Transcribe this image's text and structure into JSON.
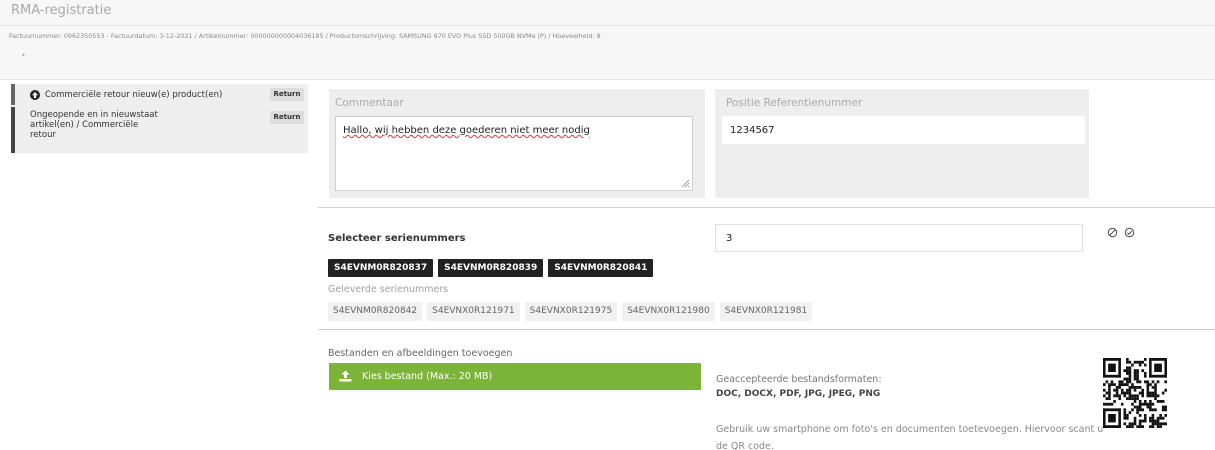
{
  "page": {
    "title": "RMA-registratie",
    "invoice_info": "Factuurnummer: 0962350553 - Factuurdatum: 3-12-2021 / Artikelnummer: 000000000004036185 / Productomschrijving: SAMSUNG 970 EVO Plus SSD 500GB NVMe (P) / Hoeveelheid: 8",
    "dot": "•"
  },
  "sidebar": {
    "items": [
      {
        "label": "Commerciële retour nieuw(e) product(en)",
        "badge": "Return",
        "icon": "arrow-up-circle-icon"
      },
      {
        "label_lines": [
          "Ongeopende en in nieuwstaat",
          "artikel(en) / Commerciële",
          "retour"
        ],
        "badge": "Return"
      }
    ]
  },
  "comment": {
    "label": "Commentaar",
    "value": "Hallo, wij hebben deze goederen niet meer nodig"
  },
  "reference": {
    "label": "Positie Referentienummer",
    "value": "1234567"
  },
  "serials": {
    "title": "Selecteer serienummers",
    "count_value": "3",
    "selected": [
      "S4EVNM0R820837",
      "S4EVNM0R820839",
      "S4EVNM0R820841"
    ],
    "delivered_label": "Geleverde serienummers",
    "delivered": [
      "S4EVNM0R820842",
      "S4EVNX0R121971",
      "S4EVNX0R121975",
      "S4EVNX0R121980",
      "S4EVNX0R121981"
    ]
  },
  "upload": {
    "section_label": "Bestanden en afbeeldingen toevoegen",
    "button_label": "Kies bestand (Max.: 20 MB)",
    "formats_label": "Geaccepteerde bestandsformaten:",
    "formats": "DOC, DOCX, PDF, JPG, JPEG, PNG",
    "qr_hint": "Gebruik uw smartphone om foto's en documenten toetevoegen. Hiervoor scant u de QR code."
  },
  "colors": {
    "accent_green": "#7cb43a",
    "chip_dark": "#222222",
    "panel_gray": "#eeeeee"
  }
}
